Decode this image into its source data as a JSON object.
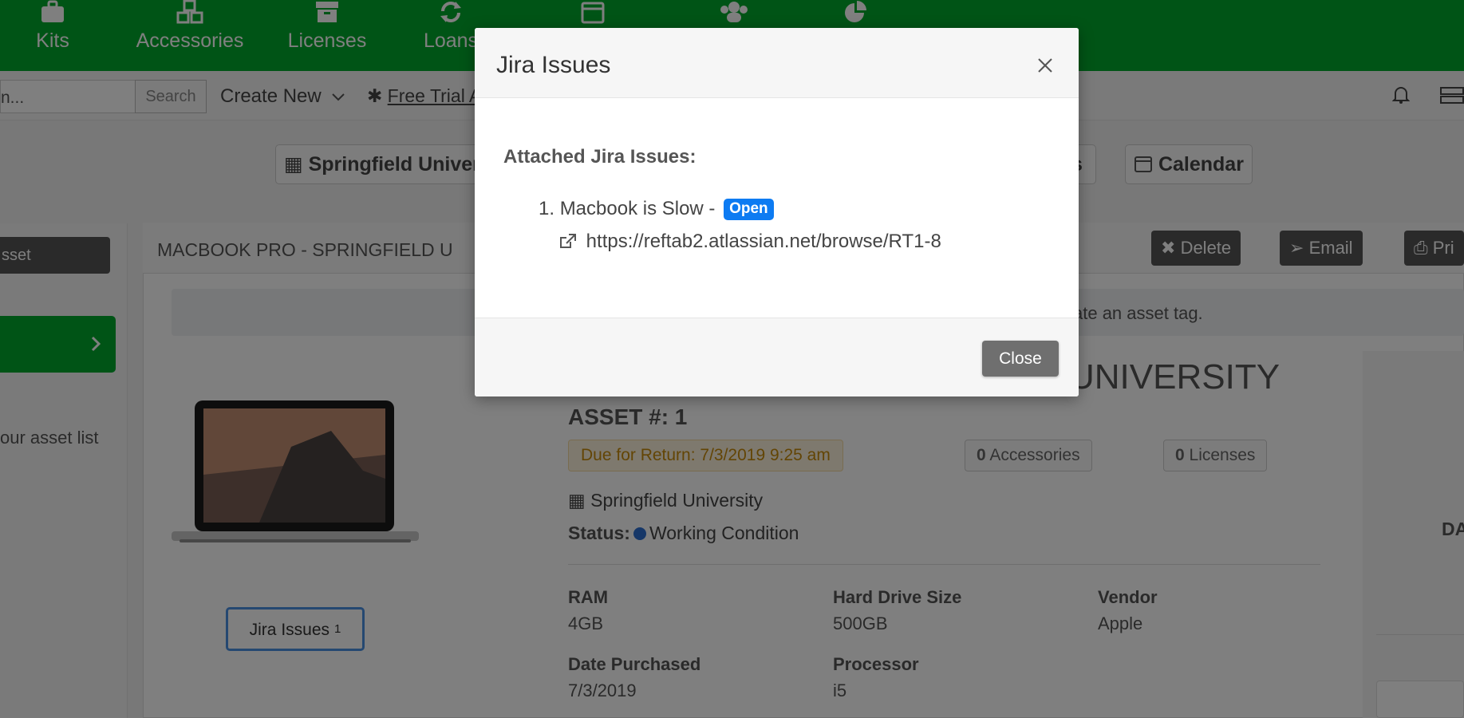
{
  "topnav": {
    "items": [
      {
        "label": "Kits",
        "icon": "briefcase-icon"
      },
      {
        "label": "Accessories",
        "icon": "cubes-icon"
      },
      {
        "label": "Licenses",
        "icon": "archive-icon"
      },
      {
        "label": "Loans",
        "icon": "refresh-icon"
      },
      {
        "label": "",
        "icon": "calendar-icon"
      },
      {
        "label": "",
        "icon": "users-icon"
      },
      {
        "label": "",
        "icon": "pie-chart-icon"
      }
    ],
    "color": "#00a82d"
  },
  "subbar": {
    "search_value": "n...",
    "search_button": "Search",
    "create_new": "Create New",
    "free_trial": "Free Trial A"
  },
  "tabs": {
    "location": "Springfield Univer",
    "hidden_tab": "s",
    "calendar": "Calendar"
  },
  "left": {
    "asset_button": "sset",
    "asset_list_text": "our asset list"
  },
  "card": {
    "title": "MACBOOK PRO - SPRINGFIELD U",
    "actions": {
      "delete": "Delete",
      "email": "Email",
      "print": "Pri"
    },
    "info_text": "ate an asset tag.",
    "jira_button": "Jira Issues",
    "jira_count": "1"
  },
  "asset": {
    "title_fragment": "UNIVERSITY",
    "asset_number_label": "ASSET #: 1",
    "due_badge": "Due for Return: 7/3/2019 9:25 am",
    "accessories_count": "0",
    "accessories_label": "Accessories",
    "licenses_count": "0",
    "licenses_label": "Licenses",
    "location": "Springfield University",
    "status_label": "Status:",
    "status_value": "Working Condition",
    "status_color": "#2c6fd1",
    "specs": [
      {
        "key": "RAM",
        "value": "4GB"
      },
      {
        "key": "Hard Drive Size",
        "value": "500GB"
      },
      {
        "key": "Vendor",
        "value": "Apple"
      },
      {
        "key": "Date Purchased",
        "value": "7/3/2019"
      },
      {
        "key": "Processor",
        "value": "i5"
      }
    ]
  },
  "right": {
    "da_text": "DA"
  },
  "modal": {
    "title": "Jira Issues",
    "heading": "Attached Jira Issues:",
    "issues": [
      {
        "number": "1.",
        "title": "Macbook is Slow -",
        "status": "Open",
        "status_color": "#0d7bf2",
        "url": "https://reftab2.atlassian.net/browse/RT1-8"
      }
    ],
    "close_button": "Close"
  }
}
